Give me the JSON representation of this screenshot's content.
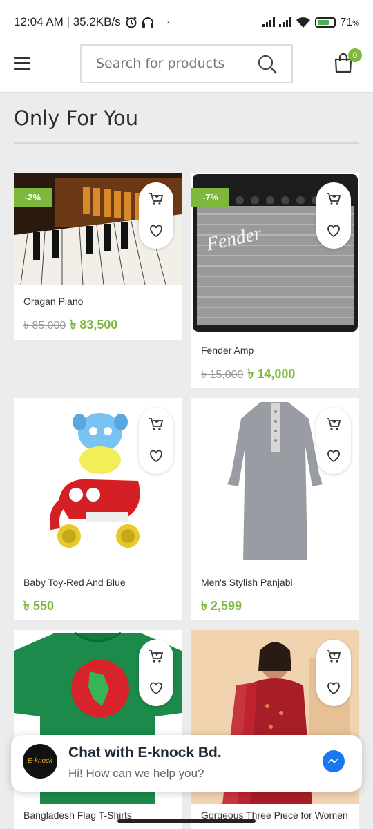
{
  "status_bar": {
    "time_speed": "12:04 AM | 35.2KB/s",
    "battery_percent": "71",
    "battery_unit": "%"
  },
  "header": {
    "search_placeholder": "Search for products",
    "cart_count": "0"
  },
  "section": {
    "title": "Only For You"
  },
  "products": [
    {
      "name": "Oragan Piano",
      "old_price": "৳ 85,000",
      "price": "৳ 83,500",
      "sale": "-2%"
    },
    {
      "name": "Fender Amp",
      "old_price": "৳ 15,000",
      "price": "৳ 14,000",
      "sale": "-7%"
    },
    {
      "name": "Baby Toy-Red And Blue",
      "old_price": "",
      "price": "৳ 550",
      "sale": ""
    },
    {
      "name": "Men's Stylish Panjabi",
      "old_price": "",
      "price": "৳ 2,599",
      "sale": ""
    },
    {
      "name": "Bangladesh Flag T-Shirts",
      "old_price": "",
      "price": "",
      "sale": ""
    },
    {
      "name": "Gorgeous Three Piece for Women",
      "old_price": "",
      "price": "",
      "sale": ""
    }
  ],
  "chat": {
    "title": "Chat with E-knock Bd.",
    "subtitle": "Hi! How can we help you?",
    "logo_text": "E-knock"
  },
  "colors": {
    "accent": "#7db83d",
    "messenger": "#1877f2"
  }
}
